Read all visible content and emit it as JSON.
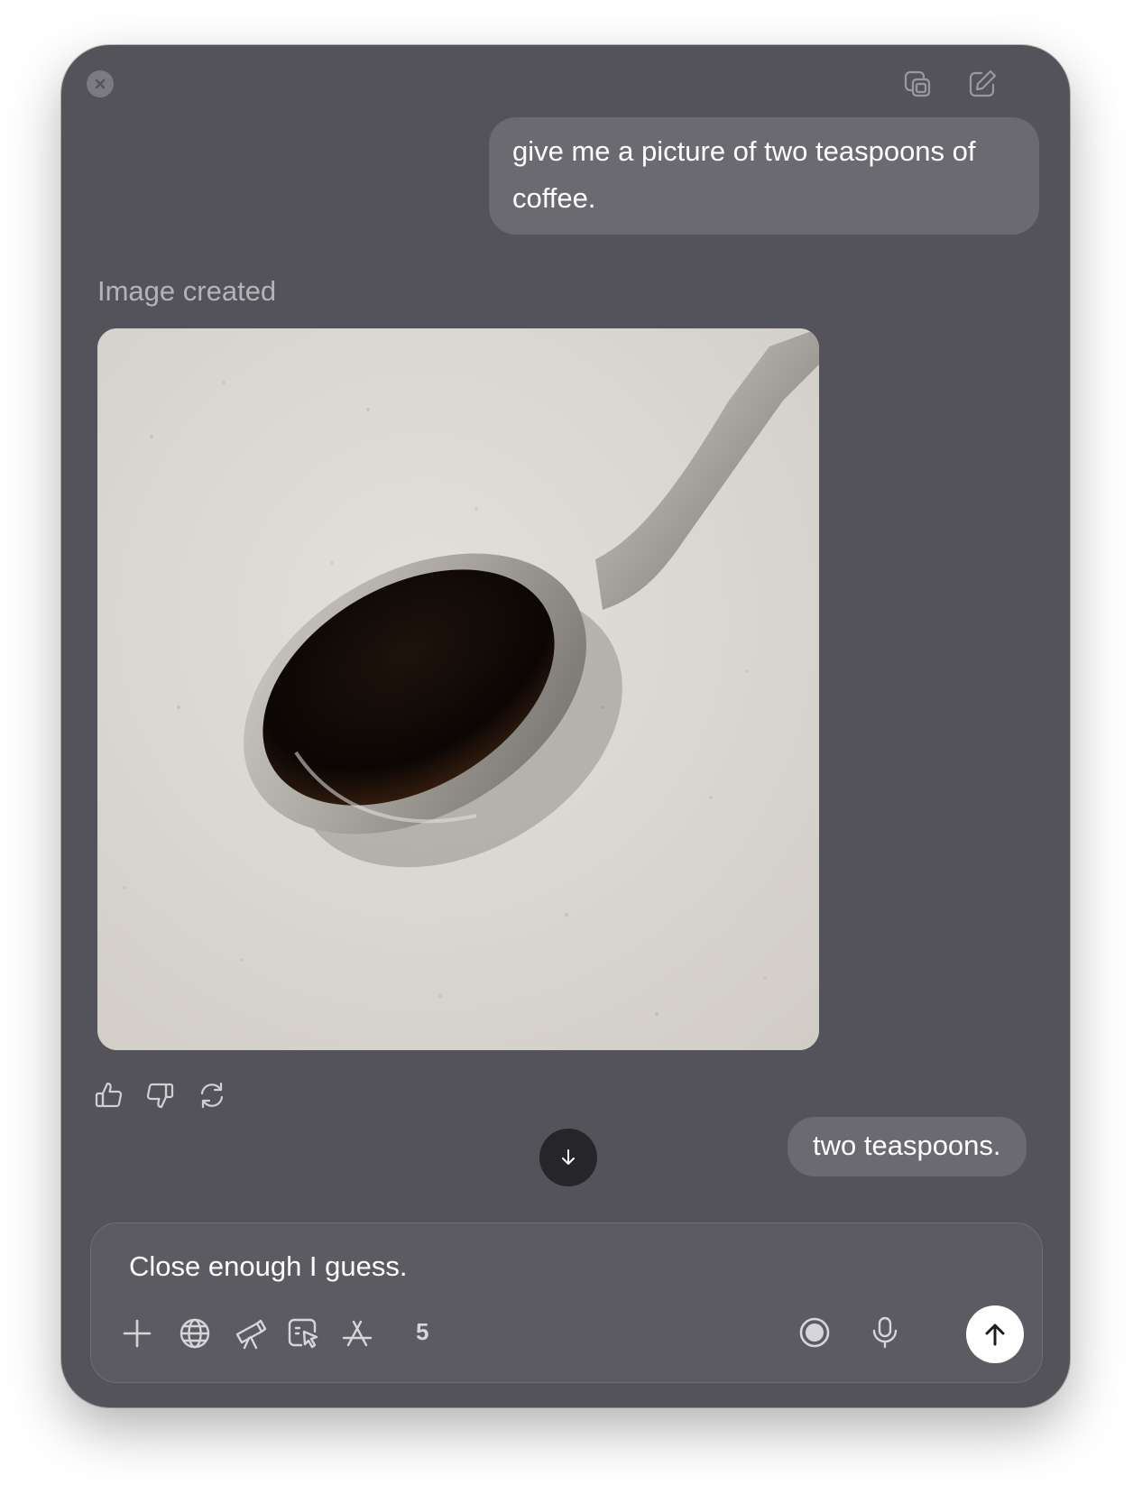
{
  "window": {
    "close_icon": "close-icon",
    "new_window_icon": "new-window-icon",
    "new_chat_icon": "compose-icon"
  },
  "conversation": {
    "messages": [
      {
        "role": "user",
        "text": "give me a picture of two teaspoons of coffee."
      },
      {
        "role": "assistant",
        "status": "Image created",
        "image": "teaspoon-of-black-coffee-photo"
      },
      {
        "role": "user",
        "text": "two teaspoons."
      }
    ],
    "message_actions": [
      "thumbs-up-icon",
      "thumbs-down-icon",
      "regenerate-icon"
    ],
    "scroll_down_icon": "arrow-down-icon"
  },
  "composer": {
    "text": "Close enough I guess.",
    "tools": [
      "plus-icon",
      "globe-icon",
      "telescope-icon",
      "canvas-icon",
      "app-store-icon"
    ],
    "tools_count": "5",
    "voice_mode_icon": "voice-mode-icon",
    "mic_icon": "mic-icon",
    "send_icon": "arrow-up-icon"
  },
  "colors": {
    "window_bg": "#545359",
    "bubble_bg": "#6b6a70",
    "composer_bg": "#5c5b61",
    "muted_text": "#b4b3b8",
    "send_button": "#ffffff"
  }
}
